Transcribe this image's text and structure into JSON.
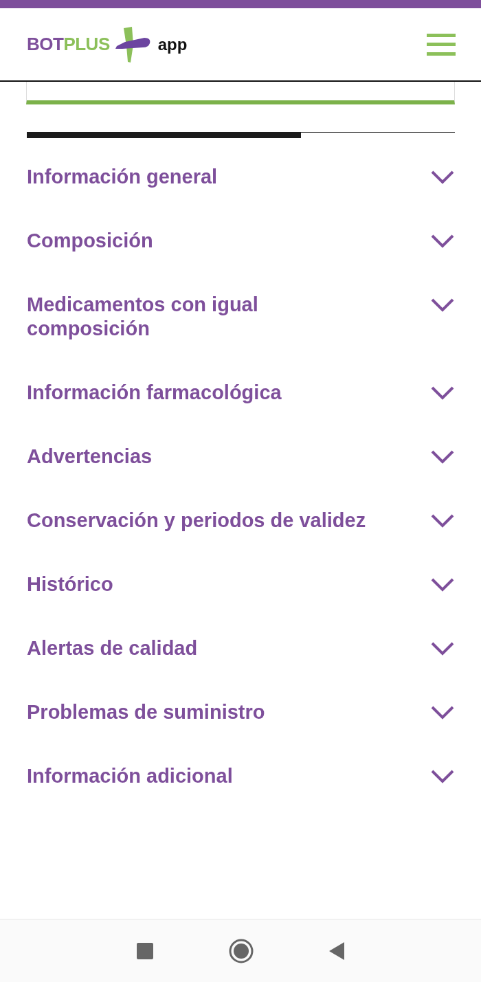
{
  "header": {
    "logo": {
      "part_1": "BOT",
      "part_2": "PLUS",
      "suffix": "app"
    }
  },
  "sections": [
    {
      "title": "Información general",
      "expanded": false
    },
    {
      "title": "Composición",
      "expanded": false
    },
    {
      "title": "Medicamentos con igual\ncomposición",
      "expanded": false
    },
    {
      "title": "Información farmacológica",
      "expanded": false
    },
    {
      "title": "Advertencias",
      "expanded": false
    },
    {
      "title": "Conservación y periodos de validez",
      "expanded": false
    },
    {
      "title": "Histórico",
      "expanded": false
    },
    {
      "title": "Alertas de calidad",
      "expanded": false
    },
    {
      "title": "Problemas de suministro",
      "expanded": false
    },
    {
      "title": "Información adicional",
      "expanded": false
    }
  ]
}
